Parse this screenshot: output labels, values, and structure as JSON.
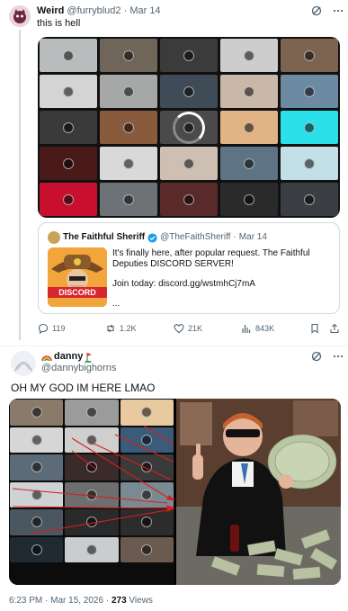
{
  "tweet1": {
    "display_name": "Weird",
    "handle": "@furryblud2",
    "dot": "·",
    "date": "Mar 14",
    "text": "this is hell",
    "media_grid_colors": [
      "#b9bcbd",
      "#6f6558",
      "#3b3b3b",
      "#cdcdcd",
      "#7c6450",
      "#d4d4d4",
      "#a6a8a8",
      "#3f4b57",
      "#c9b8a8",
      "#6d8aa3",
      "#3a3a3a",
      "#8a5a3c",
      "#4a4a4a",
      "#e2b483",
      "#2be0e8",
      "#4a1a1a",
      "#d9d9d9",
      "#cdbfb2",
      "#5e7384",
      "#c2e0e6",
      "#c8102e",
      "#6d7277",
      "#5a2a2a",
      "#2a2a2a",
      "#3b3f44"
    ],
    "quote": {
      "display_name": "The Faithful Sheriff",
      "handle": "@TheFaithSheriff",
      "dot": "·",
      "date": "Mar 14",
      "text_1": "It's finally here, after popular request. The Faithful Deputies DISCORD SERVER!",
      "text_2": "Join today: discord.gg/wstmhCj7mA",
      "text_3": "...",
      "image_label": "DISCORD"
    },
    "actions": {
      "replies": "119",
      "retweets": "1.2K",
      "likes": "21K",
      "views": "843K"
    }
  },
  "tweet2": {
    "display_name": "danny",
    "handle": "@dannybighorns",
    "text": "OH MY GOD IM HERE LMAO",
    "media_left_colors": [
      "#8a7a6a",
      "#9b9b9b",
      "#e8c9a0",
      "#d6d6d6",
      "#cfcfcf",
      "#3c5a7a",
      "#5d6b78",
      "#3a2a2a",
      "#3a3a3a",
      "#cfd3d6",
      "#6e6e6e",
      "#7a8a93",
      "#4a5660",
      "#2a2a2a",
      "#2c2c2c",
      "#1f2a33",
      "#c9cdd0",
      "#6a5a50"
    ],
    "timestamp": "6:23 PM · Mar 15, 2026",
    "views_count": "273",
    "views_label": "Views"
  },
  "colors": {
    "text": "#0f1419",
    "muted": "#536471",
    "verified": "#1d9bf0",
    "border": "#cfd9de"
  }
}
